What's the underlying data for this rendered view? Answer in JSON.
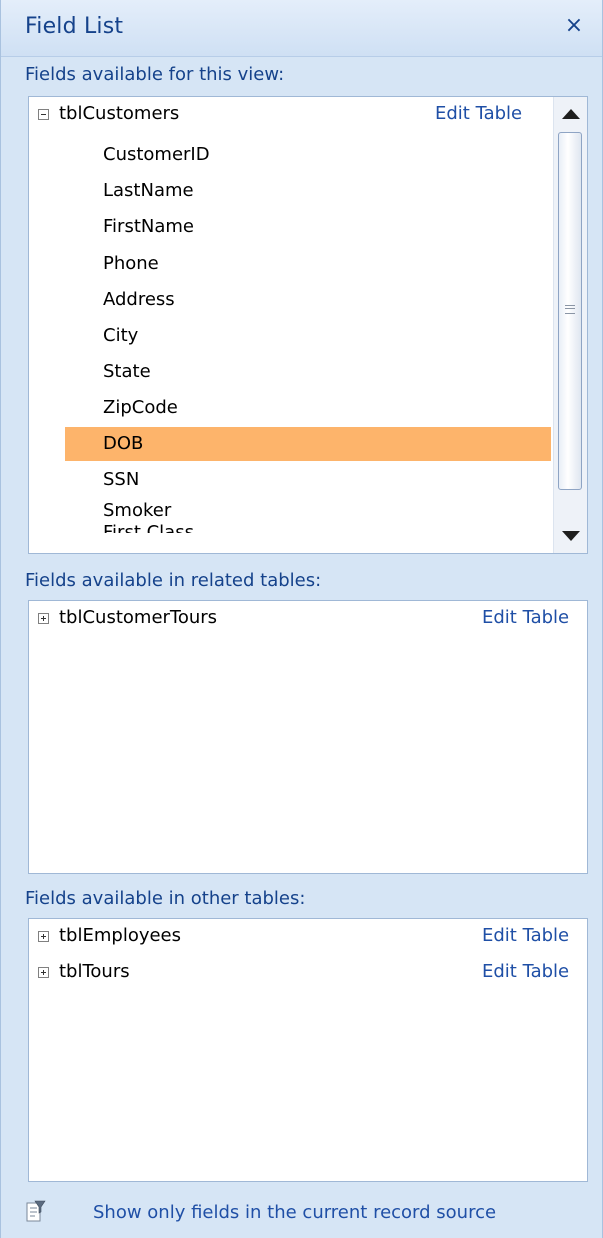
{
  "panel": {
    "title": "Field List",
    "close_glyph": "×"
  },
  "sections": {
    "view": {
      "label": "Fields available for this view:",
      "table": {
        "name": "tblCustomers",
        "edit_label": "Edit Table",
        "expanded": true
      },
      "fields": [
        "CustomerID",
        "LastName",
        "FirstName",
        "Phone",
        "Address",
        "City",
        "State",
        "ZipCode",
        "DOB",
        "SSN",
        "Smoker"
      ],
      "selected_field": "DOB",
      "cutoff_field": "First Class"
    },
    "related": {
      "label": "Fields available in related tables:",
      "tables": [
        {
          "name": "tblCustomerTours",
          "edit_label": "Edit Table"
        }
      ]
    },
    "other": {
      "label": "Fields available in other tables:",
      "tables": [
        {
          "name": "tblEmployees",
          "edit_label": "Edit Table"
        },
        {
          "name": "tblTours",
          "edit_label": "Edit Table"
        }
      ]
    }
  },
  "footer": {
    "link": "Show only fields in the current record source"
  },
  "colors": {
    "title": "#15428b",
    "link": "#1f4fa6",
    "selected": "#fdb46b",
    "panel_bg": "#d6e5f5"
  },
  "icons": {
    "close": "close-icon",
    "collapse": "minus-box-icon",
    "expand": "plus-box-icon",
    "filter": "filter-fields-icon"
  }
}
